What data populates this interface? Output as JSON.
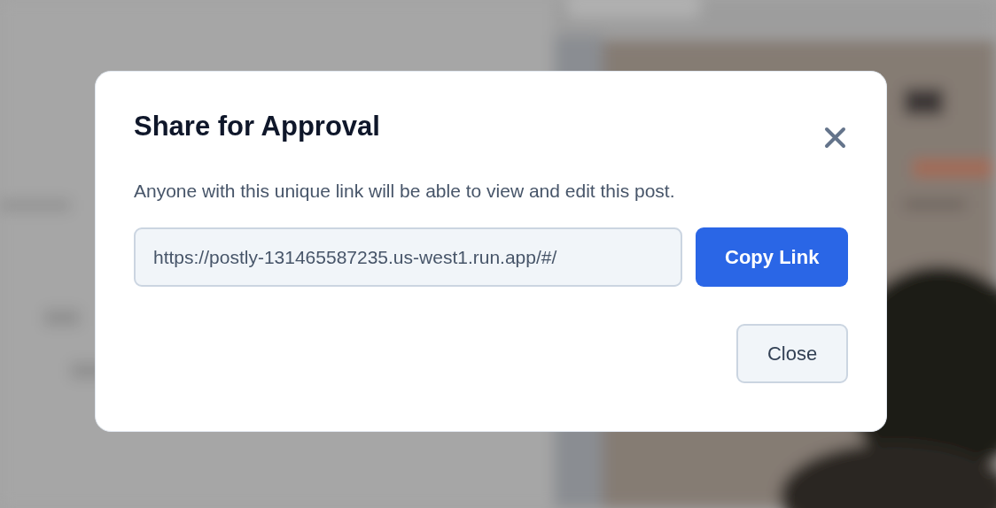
{
  "dialog": {
    "title": "Share for Approval",
    "description": "Anyone with this unique link will be able to view and edit this post.",
    "link_field": {
      "value": "https://postly-131465587235.us-west1.run.app/#/"
    },
    "buttons": [
      {
        "label": "Copy Link",
        "kind": "primary"
      },
      {
        "label": "Close",
        "kind": "secondary"
      }
    ]
  }
}
